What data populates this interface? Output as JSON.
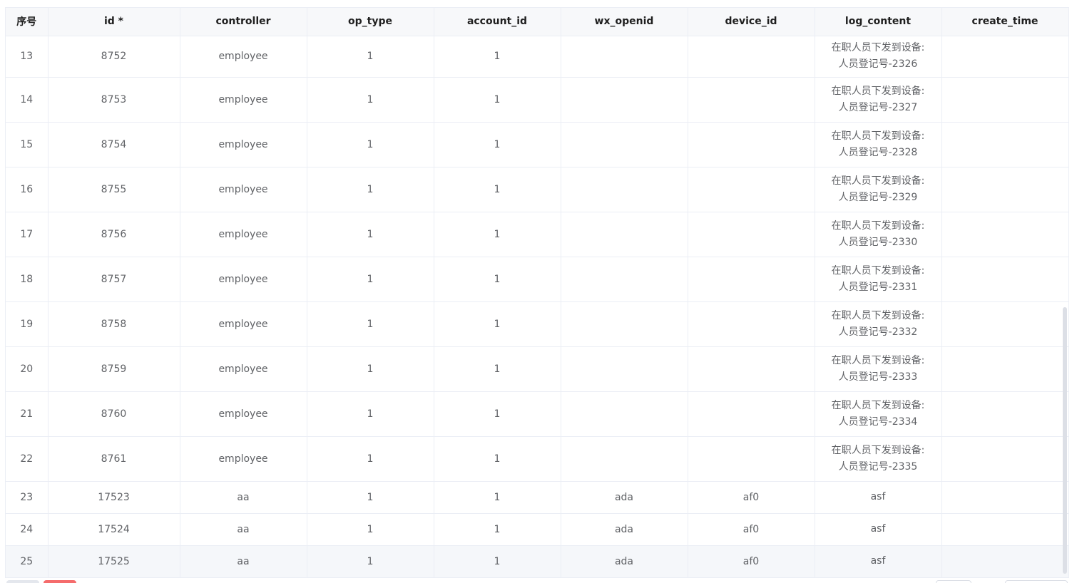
{
  "table": {
    "columns": [
      "序号",
      "id *",
      "controller",
      "op_type",
      "account_id",
      "wx_openid",
      "device_id",
      "log_content",
      "create_time"
    ],
    "rows": [
      {
        "seq": "13",
        "id": "8752",
        "controller": "employee",
        "op_type": "1",
        "account_id": "1",
        "wx_openid": "",
        "device_id": "",
        "log_line1": "在职人员下发到设备:",
        "log_line2": "人员登记号-2326",
        "create_time": ""
      },
      {
        "seq": "14",
        "id": "8753",
        "controller": "employee",
        "op_type": "1",
        "account_id": "1",
        "wx_openid": "",
        "device_id": "",
        "log_line1": "在职人员下发到设备:",
        "log_line2": "人员登记号-2327",
        "create_time": ""
      },
      {
        "seq": "15",
        "id": "8754",
        "controller": "employee",
        "op_type": "1",
        "account_id": "1",
        "wx_openid": "",
        "device_id": "",
        "log_line1": "在职人员下发到设备:",
        "log_line2": "人员登记号-2328",
        "create_time": ""
      },
      {
        "seq": "16",
        "id": "8755",
        "controller": "employee",
        "op_type": "1",
        "account_id": "1",
        "wx_openid": "",
        "device_id": "",
        "log_line1": "在职人员下发到设备:",
        "log_line2": "人员登记号-2329",
        "create_time": ""
      },
      {
        "seq": "17",
        "id": "8756",
        "controller": "employee",
        "op_type": "1",
        "account_id": "1",
        "wx_openid": "",
        "device_id": "",
        "log_line1": "在职人员下发到设备:",
        "log_line2": "人员登记号-2330",
        "create_time": ""
      },
      {
        "seq": "18",
        "id": "8757",
        "controller": "employee",
        "op_type": "1",
        "account_id": "1",
        "wx_openid": "",
        "device_id": "",
        "log_line1": "在职人员下发到设备:",
        "log_line2": "人员登记号-2331",
        "create_time": ""
      },
      {
        "seq": "19",
        "id": "8758",
        "controller": "employee",
        "op_type": "1",
        "account_id": "1",
        "wx_openid": "",
        "device_id": "",
        "log_line1": "在职人员下发到设备:",
        "log_line2": "人员登记号-2332",
        "create_time": ""
      },
      {
        "seq": "20",
        "id": "8759",
        "controller": "employee",
        "op_type": "1",
        "account_id": "1",
        "wx_openid": "",
        "device_id": "",
        "log_line1": "在职人员下发到设备:",
        "log_line2": "人员登记号-2333",
        "create_time": ""
      },
      {
        "seq": "21",
        "id": "8760",
        "controller": "employee",
        "op_type": "1",
        "account_id": "1",
        "wx_openid": "",
        "device_id": "",
        "log_line1": "在职人员下发到设备:",
        "log_line2": "人员登记号-2334",
        "create_time": ""
      },
      {
        "seq": "22",
        "id": "8761",
        "controller": "employee",
        "op_type": "1",
        "account_id": "1",
        "wx_openid": "",
        "device_id": "",
        "log_line1": "在职人员下发到设备:",
        "log_line2": "人员登记号-2335",
        "create_time": ""
      },
      {
        "seq": "23",
        "id": "17523",
        "controller": "aa",
        "op_type": "1",
        "account_id": "1",
        "wx_openid": "ada",
        "device_id": "af0",
        "log_line1": "asf",
        "log_line2": "",
        "create_time": ""
      },
      {
        "seq": "24",
        "id": "17524",
        "controller": "aa",
        "op_type": "1",
        "account_id": "1",
        "wx_openid": "ada",
        "device_id": "af0",
        "log_line1": "asf",
        "log_line2": "",
        "create_time": ""
      },
      {
        "seq": "25",
        "id": "17525",
        "controller": "aa",
        "op_type": "1",
        "account_id": "1",
        "wx_openid": "ada",
        "device_id": "af0",
        "log_line1": "asf",
        "log_line2": "",
        "create_time": ""
      }
    ]
  },
  "colors": {
    "header_bg": "#f7f8fa",
    "border": "#ebeef5",
    "text": "#606266",
    "hover_row": "#f5f7fa",
    "danger": "#f56c6c"
  }
}
